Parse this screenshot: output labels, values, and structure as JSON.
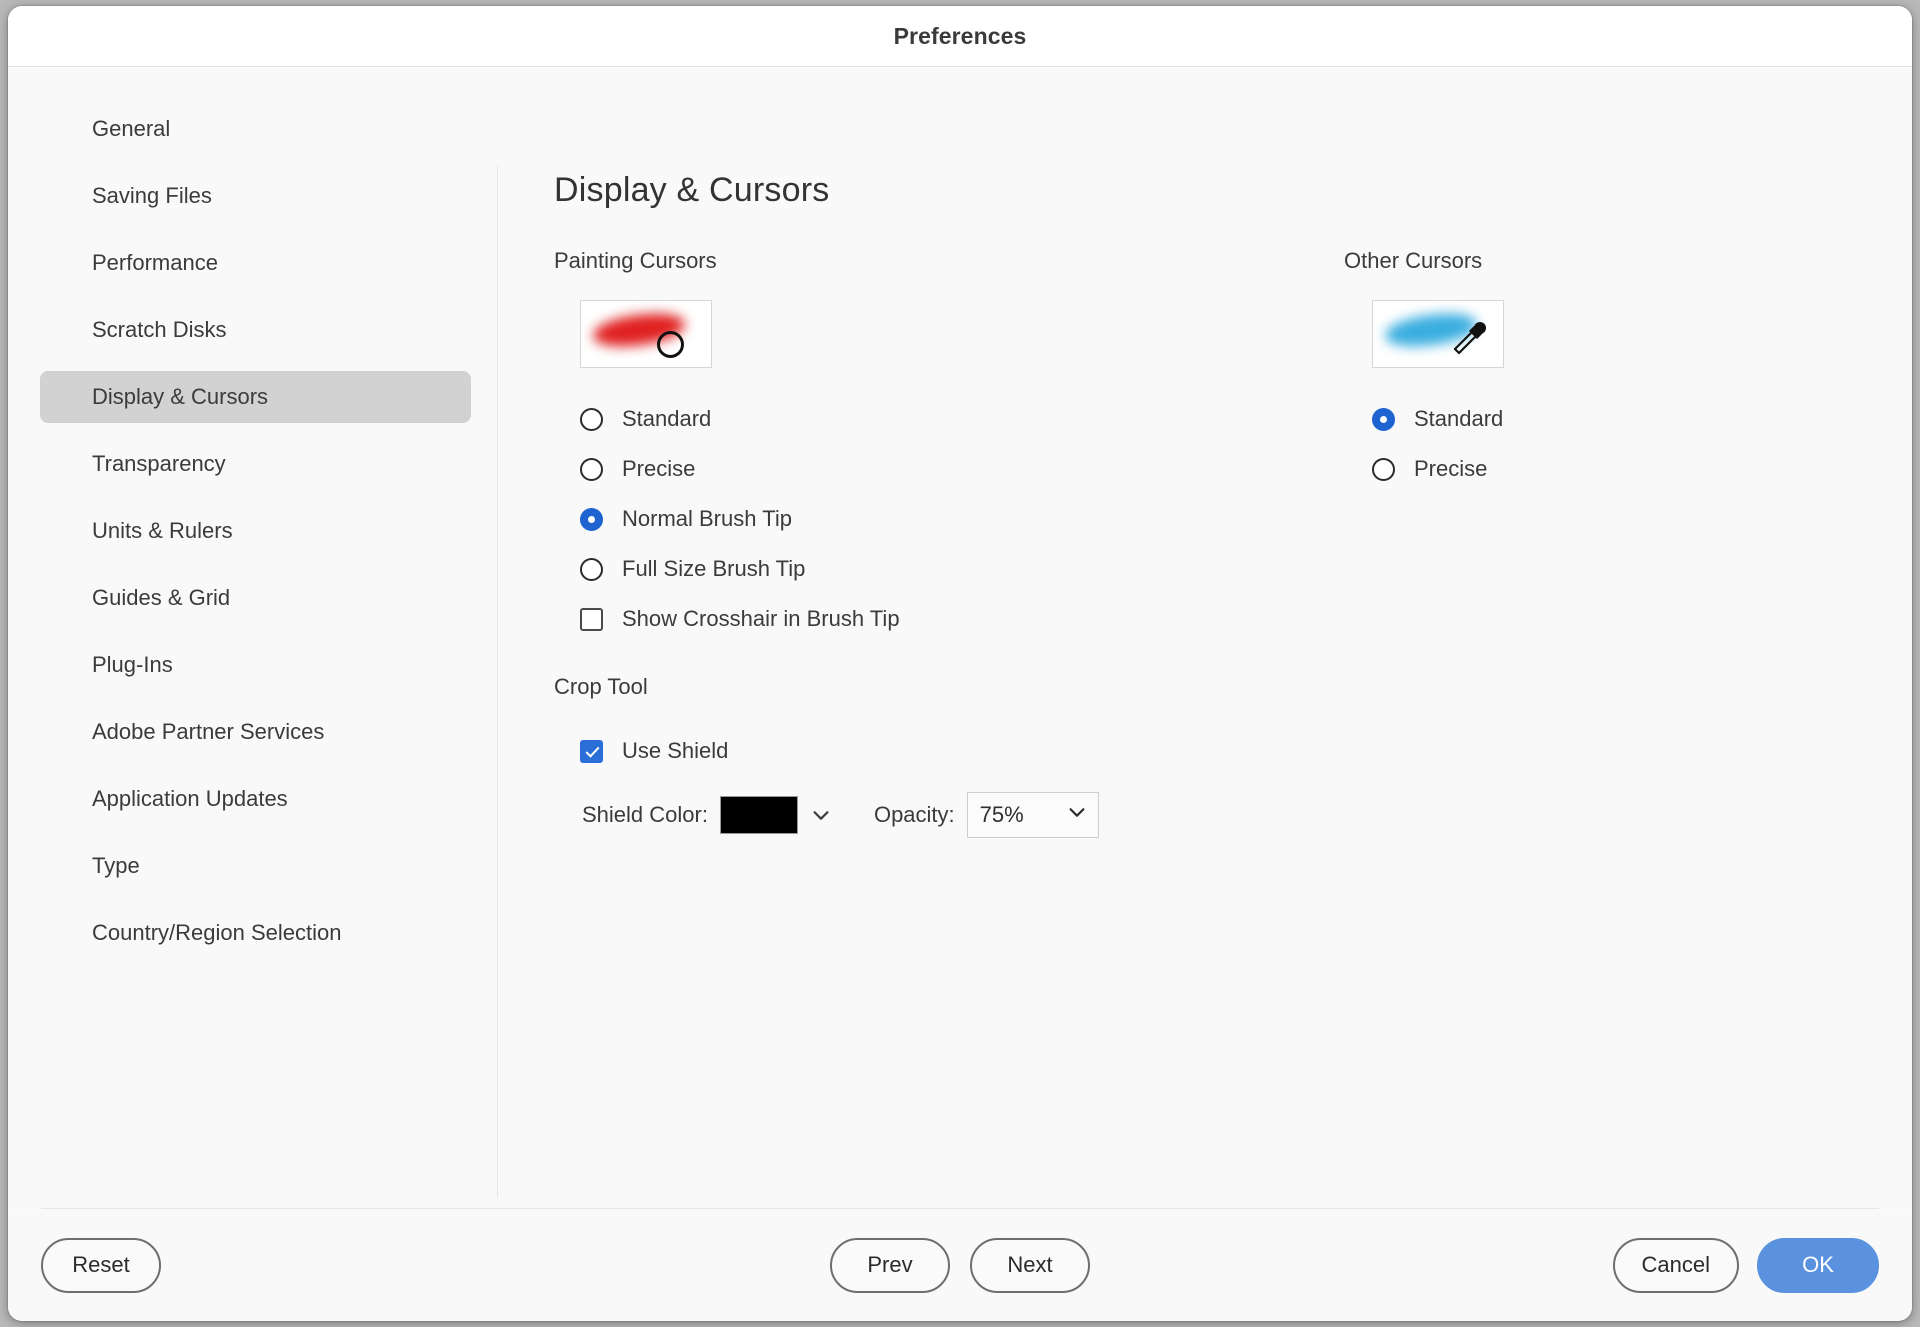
{
  "window": {
    "title": "Preferences"
  },
  "sidebar": {
    "items": [
      {
        "label": "General",
        "selected": false
      },
      {
        "label": "Saving Files",
        "selected": false
      },
      {
        "label": "Performance",
        "selected": false
      },
      {
        "label": "Scratch Disks",
        "selected": false
      },
      {
        "label": "Display & Cursors",
        "selected": true
      },
      {
        "label": "Transparency",
        "selected": false
      },
      {
        "label": "Units & Rulers",
        "selected": false
      },
      {
        "label": "Guides & Grid",
        "selected": false
      },
      {
        "label": "Plug-Ins",
        "selected": false
      },
      {
        "label": "Adobe Partner Services",
        "selected": false
      },
      {
        "label": "Application Updates",
        "selected": false
      },
      {
        "label": "Type",
        "selected": false
      },
      {
        "label": "Country/Region Selection",
        "selected": false
      }
    ]
  },
  "main": {
    "page_title": "Display & Cursors",
    "painting_cursors": {
      "group_label": "Painting Cursors",
      "preview_color": "#e02020",
      "options": [
        {
          "label": "Standard",
          "selected": false
        },
        {
          "label": "Precise",
          "selected": false
        },
        {
          "label": "Normal Brush Tip",
          "selected": true
        },
        {
          "label": "Full Size Brush Tip",
          "selected": false
        }
      ],
      "crosshair_checkbox": {
        "label": "Show Crosshair in Brush Tip",
        "checked": false
      }
    },
    "other_cursors": {
      "group_label": "Other Cursors",
      "preview_color": "#3aaee0",
      "options": [
        {
          "label": "Standard",
          "selected": true
        },
        {
          "label": "Precise",
          "selected": false
        }
      ]
    },
    "crop_tool": {
      "group_label": "Crop Tool",
      "use_shield": {
        "label": "Use Shield",
        "checked": true
      },
      "shield_color_label": "Shield Color:",
      "shield_color_value": "#000000",
      "opacity_label": "Opacity:",
      "opacity_value": "75%"
    }
  },
  "footer": {
    "reset": "Reset",
    "prev": "Prev",
    "next": "Next",
    "cancel": "Cancel",
    "ok": "OK"
  },
  "colors": {
    "accent_radio": "#1f63d0",
    "accent_checkbox": "#2a6fd8",
    "primary_button": "#5a92e0",
    "selected_nav": "#d2d2d2"
  }
}
